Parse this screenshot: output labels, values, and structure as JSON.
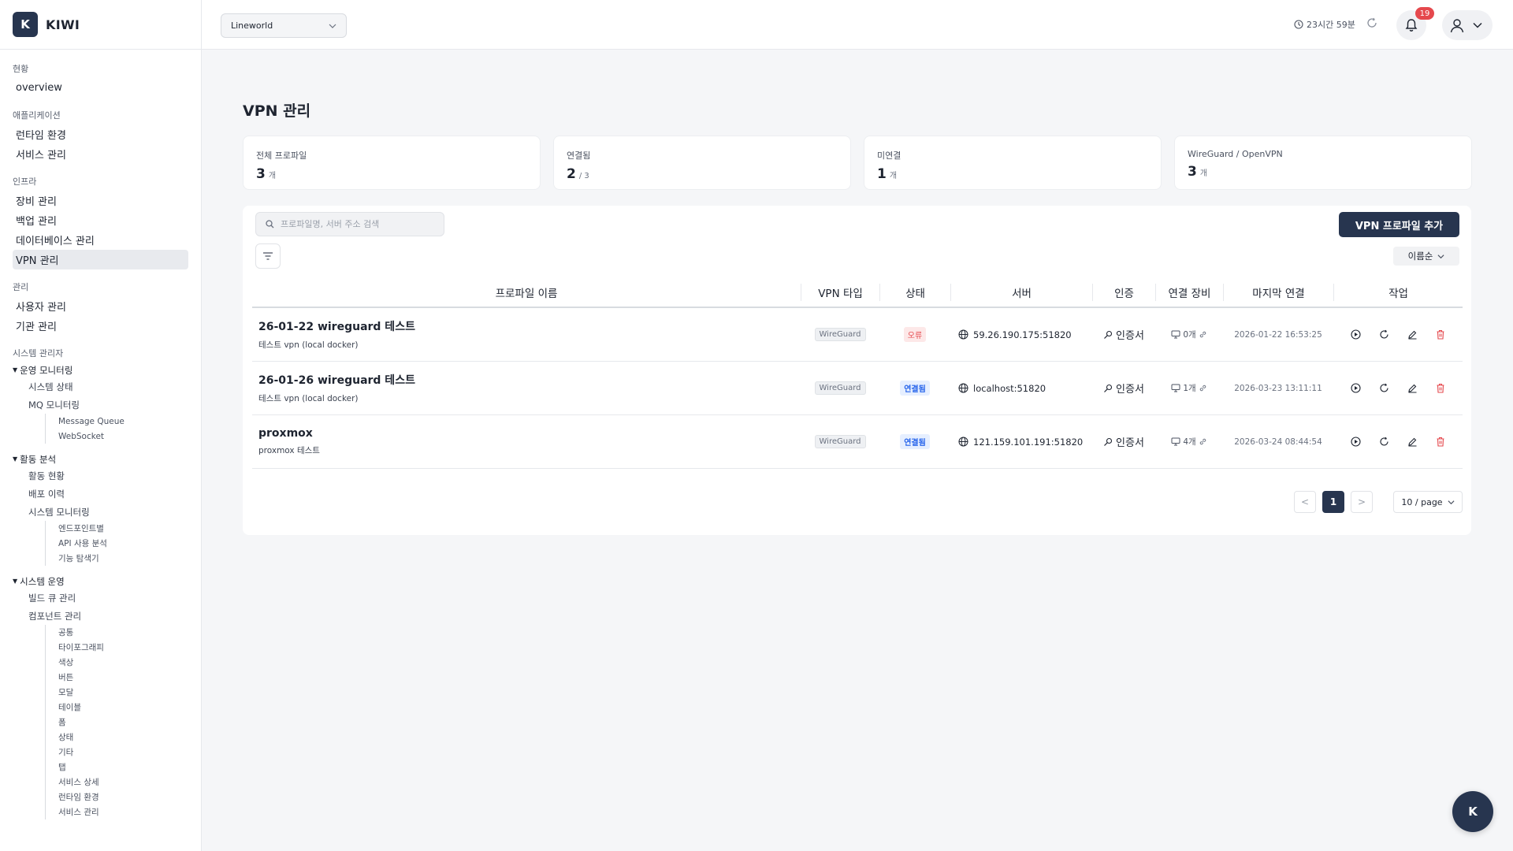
{
  "app": {
    "logo_letter": "K",
    "name": "KIWI"
  },
  "sidebar": {
    "sections": [
      {
        "title": "현황",
        "items": [
          {
            "label": "overview"
          }
        ]
      },
      {
        "title": "애플리케이션",
        "items": [
          {
            "label": "런타임 환경"
          },
          {
            "label": "서비스 관리"
          }
        ]
      },
      {
        "title": "인프라",
        "items": [
          {
            "label": "장비 관리"
          },
          {
            "label": "백업 관리"
          },
          {
            "label": "데이터베이스 관리"
          },
          {
            "label": "VPN 관리"
          }
        ]
      },
      {
        "title": "관리",
        "items": [
          {
            "label": "사용자 관리"
          },
          {
            "label": "기관 관리"
          }
        ]
      }
    ],
    "admin_title": "시스템 관리자",
    "groups": [
      {
        "label": "운영 모니터링",
        "subs": [
          {
            "label": "시스템 상태"
          },
          {
            "label": "MQ 모니터링"
          }
        ],
        "leaves": [
          "Message Queue",
          "WebSocket"
        ]
      },
      {
        "label": "활동 분석",
        "subs": [
          {
            "label": "활동 현황"
          },
          {
            "label": "배포 이력"
          },
          {
            "label": "시스템 모니터링"
          }
        ],
        "leaves": [
          "엔드포인트별",
          "API 사용 분석",
          "기능 탐색기"
        ]
      },
      {
        "label": "시스템 운영",
        "subs": [
          {
            "label": "빌드 큐 관리"
          },
          {
            "label": "컴포넌트 관리"
          }
        ],
        "leaves": [
          "공통",
          "타이포그래피",
          "색상",
          "버튼",
          "모달",
          "테이블",
          "폼",
          "상태",
          "기타",
          "탭",
          "서비스 상세",
          "런타임 환경",
          "서비스 관리"
        ]
      }
    ]
  },
  "topbar": {
    "org": "Lineworld",
    "session_time": "23시간 59분",
    "notif_count": "19"
  },
  "page": {
    "title": "VPN 관리",
    "stats": [
      {
        "label": "전체 프로파일",
        "value": "3",
        "unit": "개"
      },
      {
        "label": "연결됨",
        "value": "2",
        "unit": "/ 3"
      },
      {
        "label": "미연결",
        "value": "1",
        "unit": "개"
      },
      {
        "label": "WireGuard / OpenVPN",
        "value": "3",
        "unit": "개"
      }
    ],
    "search_placeholder": "프로파일명, 서버 주소 검색",
    "add_button": "VPN 프로파일 추가",
    "sort_label": "이름순",
    "columns": [
      "프로파일 이름",
      "VPN 타입",
      "상태",
      "서버",
      "인증",
      "연결 장비",
      "마지막 연결",
      "작업"
    ],
    "rows": [
      {
        "name": "26-01-22 wireguard 테스트",
        "desc": "테스트 vpn (local docker)",
        "type": "WireGuard",
        "status": "오류",
        "status_kind": "error",
        "server": "59.26.190.175:51820",
        "auth": "인증서",
        "devices": "0개",
        "last": "2026-01-22 16:53:25"
      },
      {
        "name": "26-01-26 wireguard 테스트",
        "desc": "테스트 vpn (local docker)",
        "type": "WireGuard",
        "status": "연결됨",
        "status_kind": "ok",
        "server": "localhost:51820",
        "auth": "인증서",
        "devices": "1개",
        "last": "2026-03-23 13:11:11"
      },
      {
        "name": "proxmox",
        "desc": "proxmox 테스트",
        "type": "WireGuard",
        "status": "연결됨",
        "status_kind": "ok",
        "server": "121.159.101.191:51820",
        "auth": "인증서",
        "devices": "4개",
        "last": "2026-03-24 08:44:54"
      }
    ],
    "pagination": {
      "prev": "<",
      "current": "1",
      "next": ">",
      "page_size": "10 / page"
    }
  },
  "fab_label": "K",
  "colors": {
    "brand": "#27354f",
    "error": "#e5484d",
    "ok": "#2563eb"
  }
}
